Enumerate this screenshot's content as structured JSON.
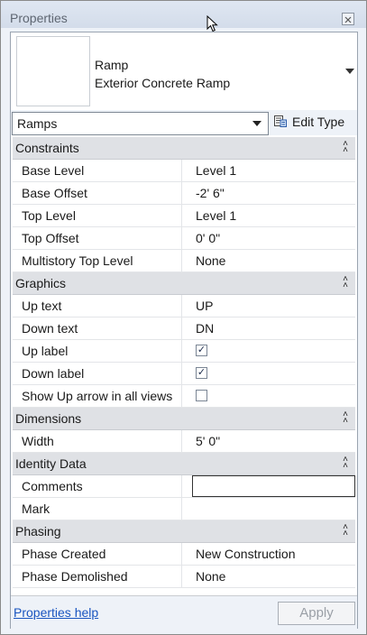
{
  "panel": {
    "title": "Properties"
  },
  "type_selector": {
    "family": "Ramp",
    "type": "Exterior Concrete Ramp"
  },
  "category_filter": {
    "value": "Ramps"
  },
  "edit_type": {
    "label": "Edit Type"
  },
  "groups": [
    {
      "name": "Constraints",
      "rows": [
        {
          "label": "Base Level",
          "value": "Level 1"
        },
        {
          "label": "Base Offset",
          "value": "-2'  6\""
        },
        {
          "label": "Top Level",
          "value": "Level 1"
        },
        {
          "label": "Top Offset",
          "value": "0'  0\""
        },
        {
          "label": "Multistory Top Level",
          "value": "None"
        }
      ]
    },
    {
      "name": "Graphics",
      "rows": [
        {
          "label": "Up text",
          "value": "UP"
        },
        {
          "label": "Down text",
          "value": "DN"
        },
        {
          "label": "Up label",
          "checked": true
        },
        {
          "label": "Down label",
          "checked": true
        },
        {
          "label": "Show Up arrow in all views",
          "checked": false
        }
      ]
    },
    {
      "name": "Dimensions",
      "rows": [
        {
          "label": "Width",
          "value": "5'  0\""
        }
      ]
    },
    {
      "name": "Identity Data",
      "rows": [
        {
          "label": "Comments",
          "value": ""
        },
        {
          "label": "Mark",
          "value": ""
        }
      ]
    },
    {
      "name": "Phasing",
      "rows": [
        {
          "label": "Phase Created",
          "value": "New Construction"
        },
        {
          "label": "Phase Demolished",
          "value": "None"
        }
      ]
    }
  ],
  "footer": {
    "help_link": "Properties help",
    "apply_label": "Apply"
  },
  "colors": {
    "link": "#1a55c0",
    "group_header": "#dfe1e5",
    "panel_bg": "#eef2f8"
  },
  "icons": {
    "close": "close-icon",
    "collapse": "collapse-icon",
    "edit_type": "edit-type-icon",
    "cursor": "cursor-arrow-icon"
  }
}
